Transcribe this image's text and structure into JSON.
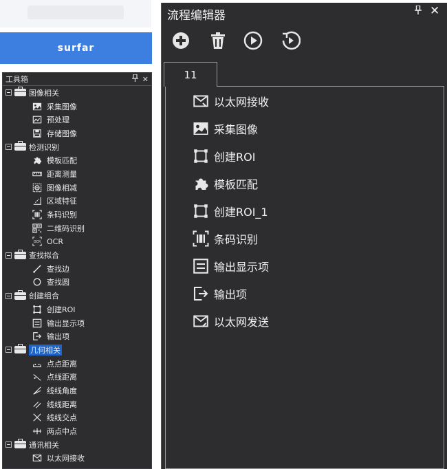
{
  "top_button": {
    "label": "surfar"
  },
  "toolbox": {
    "title": "工具箱",
    "pin_glyph": "ꟸ",
    "close_glyph": "✕",
    "rows": [
      {
        "kind": "cat",
        "label": "图像相关"
      },
      {
        "kind": "item",
        "label": "采集图像",
        "icon": "image-icon"
      },
      {
        "kind": "item",
        "label": "预处理",
        "icon": "preprocess-icon"
      },
      {
        "kind": "item",
        "label": "存储图像",
        "icon": "save-image-icon"
      },
      {
        "kind": "cat",
        "label": "检测识别"
      },
      {
        "kind": "item",
        "label": "模板匹配",
        "icon": "puzzle-icon"
      },
      {
        "kind": "item",
        "label": "距离测量",
        "icon": "ruler-icon"
      },
      {
        "kind": "item",
        "label": "图像相减",
        "icon": "subtract-icon"
      },
      {
        "kind": "item",
        "label": "区域特征",
        "icon": "region-icon"
      },
      {
        "kind": "item",
        "label": "条码识别",
        "icon": "barcode-icon"
      },
      {
        "kind": "item",
        "label": "二维码识别",
        "icon": "qrcode-icon"
      },
      {
        "kind": "item",
        "label": "OCR",
        "icon": "ocr-icon"
      },
      {
        "kind": "cat",
        "label": "查找拟合"
      },
      {
        "kind": "item",
        "label": "查找边",
        "icon": "find-edge-icon"
      },
      {
        "kind": "item",
        "label": "查找圆",
        "icon": "circle-icon"
      },
      {
        "kind": "cat",
        "label": "创建组合"
      },
      {
        "kind": "item",
        "label": "创建ROI",
        "icon": "roi-icon"
      },
      {
        "kind": "item",
        "label": "输出显示项",
        "icon": "display-output-icon"
      },
      {
        "kind": "item",
        "label": "输出项",
        "icon": "output-icon"
      },
      {
        "kind": "cat",
        "label": "几何相关",
        "selected": true
      },
      {
        "kind": "item",
        "label": "点点距离",
        "icon": "point-distance-icon"
      },
      {
        "kind": "item",
        "label": "点线距离",
        "icon": "point-line-icon"
      },
      {
        "kind": "item",
        "label": "线线角度",
        "icon": "angle-icon"
      },
      {
        "kind": "item",
        "label": "线线距离",
        "icon": "line-distance-icon"
      },
      {
        "kind": "item",
        "label": "线线交点",
        "icon": "intersection-icon"
      },
      {
        "kind": "item",
        "label": "两点中点",
        "icon": "midpoint-icon"
      },
      {
        "kind": "cat",
        "label": "通讯相关"
      },
      {
        "kind": "item",
        "label": "以太网接收",
        "icon": "ethernet-receive-icon"
      }
    ]
  },
  "editor": {
    "title": "流程编辑器",
    "pin_glyph": "ꟸ",
    "close_glyph": "✕",
    "toolbar": [
      "add-icon",
      "delete-icon",
      "run-icon",
      "run-loop-icon"
    ],
    "tab_label": "11",
    "nodes": [
      {
        "label": "以太网接收",
        "icon": "ethernet-receive-icon"
      },
      {
        "label": "采集图像",
        "icon": "image-icon"
      },
      {
        "label": "创建ROI",
        "icon": "roi-icon"
      },
      {
        "label": "模板匹配",
        "icon": "puzzle-icon"
      },
      {
        "label": "创建ROI_1",
        "icon": "roi-icon"
      },
      {
        "label": "条码识别",
        "icon": "barcode-icon"
      },
      {
        "label": "输出显示项",
        "icon": "display-output-icon"
      },
      {
        "label": "输出项",
        "icon": "output-icon"
      },
      {
        "label": "以太网发送",
        "icon": "ethernet-send-icon"
      }
    ]
  },
  "colors": {
    "panel_bg": "#2d2d30",
    "accent": "#3c7fe0",
    "selection": "#1e64c8",
    "text": "#e8e8e8"
  }
}
